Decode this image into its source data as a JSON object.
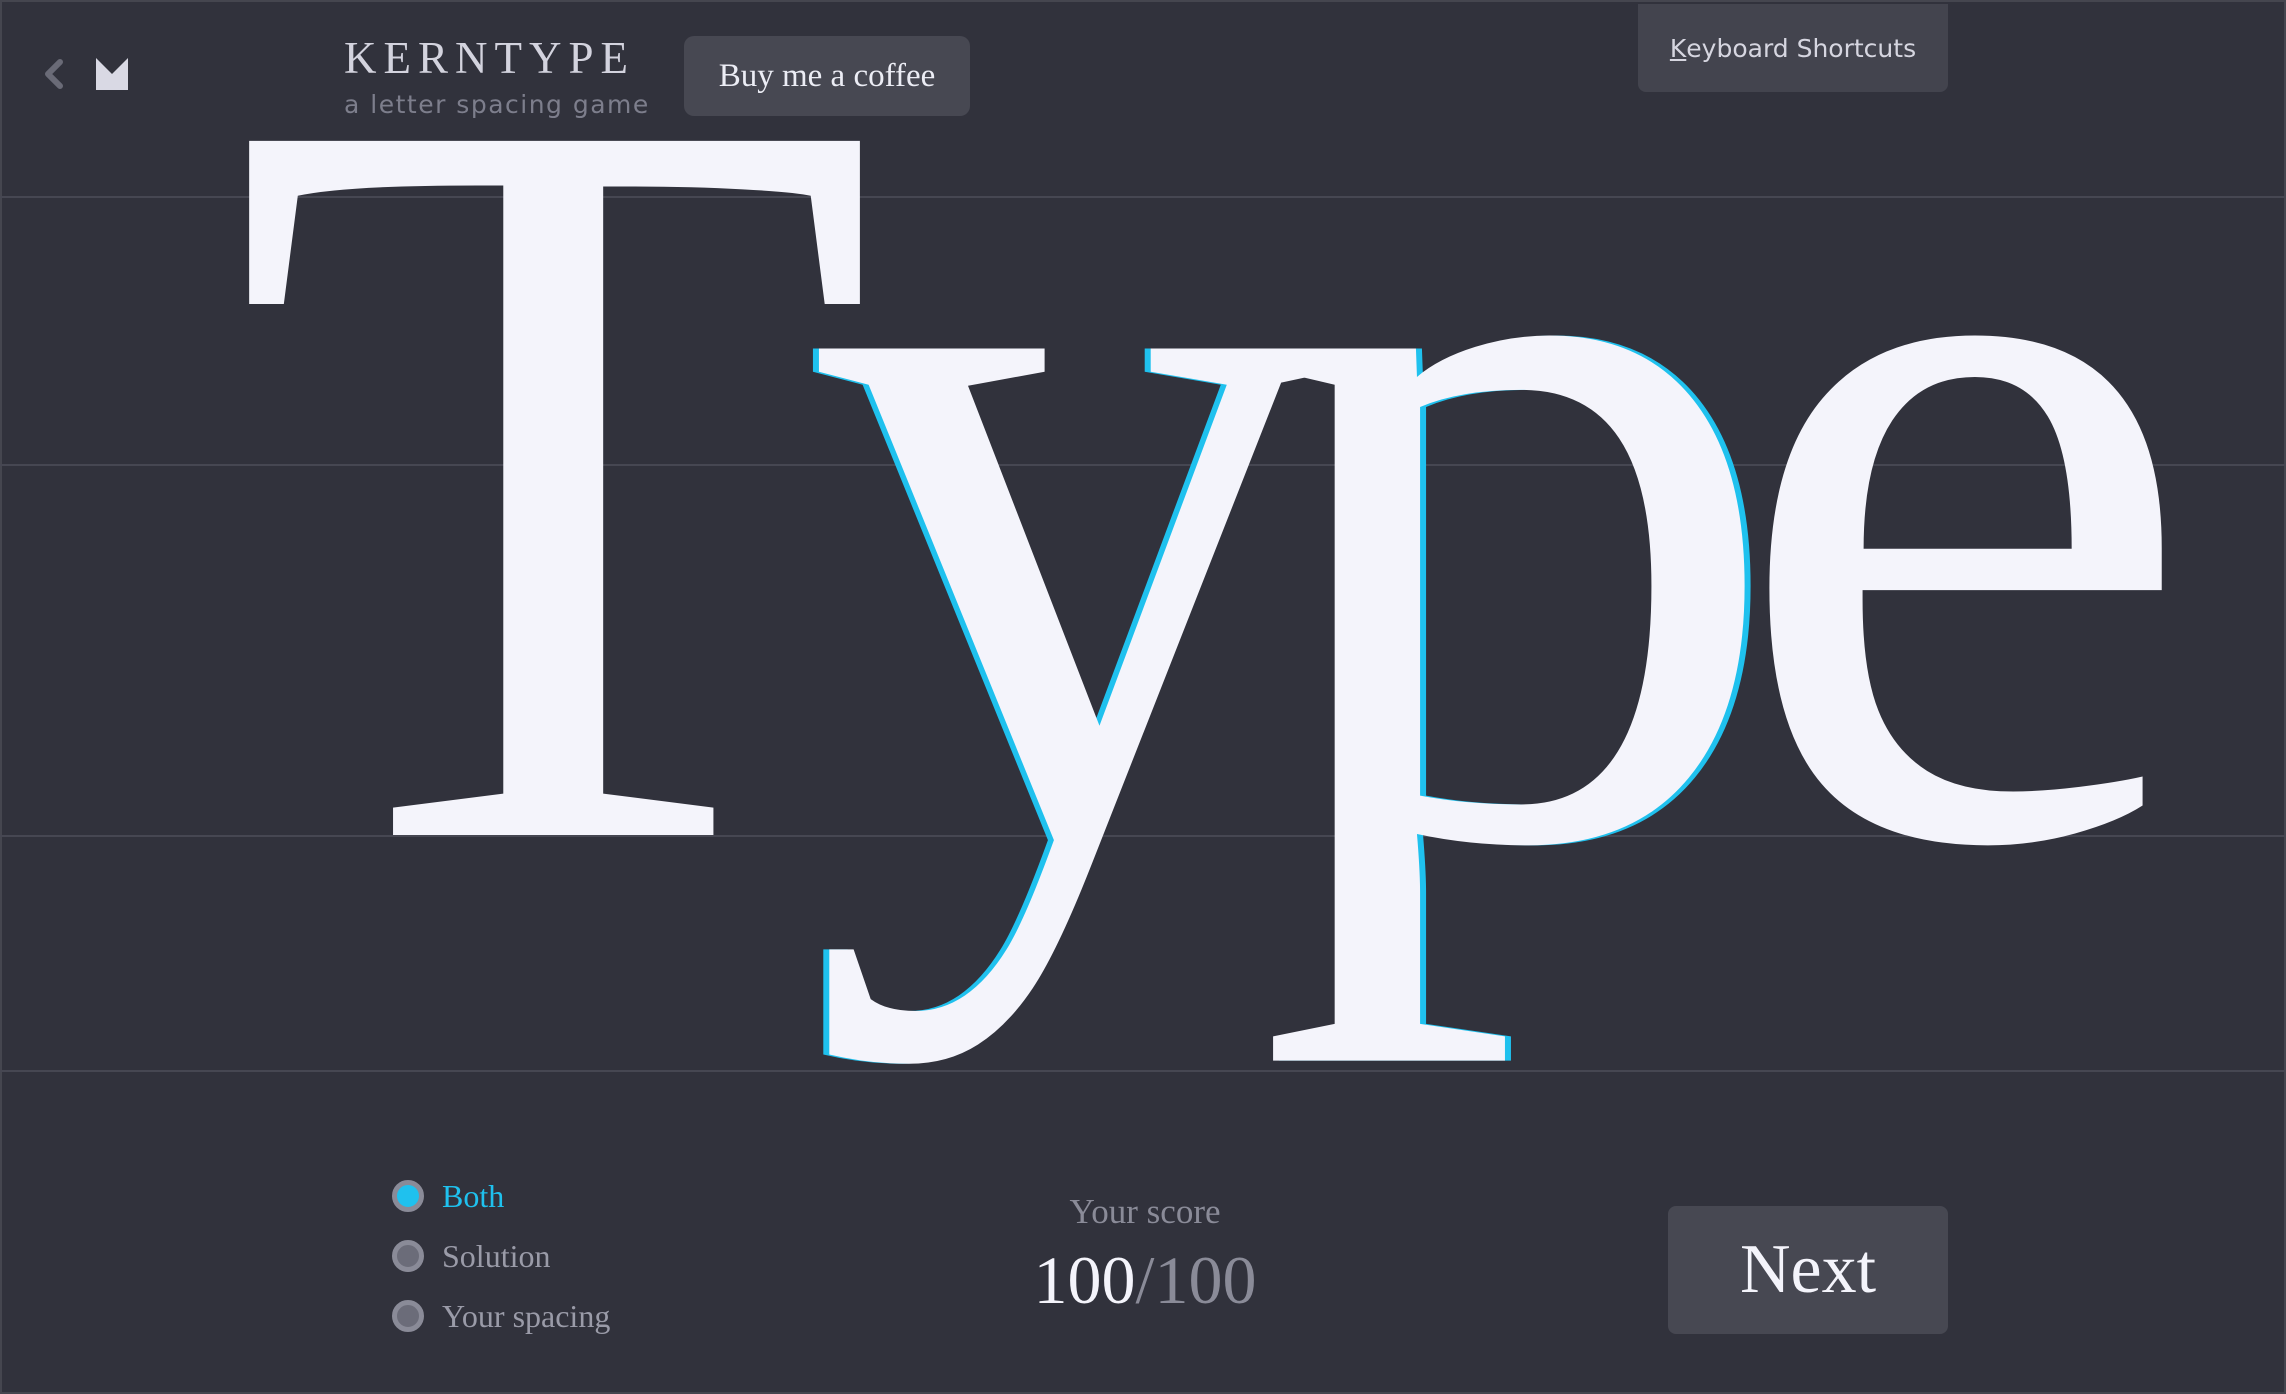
{
  "header": {
    "back_icon": "chevron-left-icon",
    "logo_icon": "m-logo-icon",
    "brand_title": "KERNTYPE",
    "brand_subtitle": "a letter spacing game",
    "coffee_button": "Buy me a coffee",
    "shortcuts_button": {
      "accesskey": "K",
      "label_rest": "eyboard Shortcuts"
    }
  },
  "word": {
    "letters": [
      "T",
      "y",
      "p",
      "e"
    ],
    "solution_outline_color": "#1fc1ee",
    "letter_color": "#f4f4fb"
  },
  "view_modes": {
    "selected": "Both",
    "options": [
      "Both",
      "Solution",
      "Your spacing"
    ]
  },
  "score": {
    "label": "Your score",
    "value": "100",
    "separator": "/",
    "max": "100"
  },
  "next_button": "Next",
  "colors": {
    "background": "#31323c",
    "accent": "#1fc1ee",
    "button": "#474852",
    "muted_text": "#8a8b98"
  }
}
